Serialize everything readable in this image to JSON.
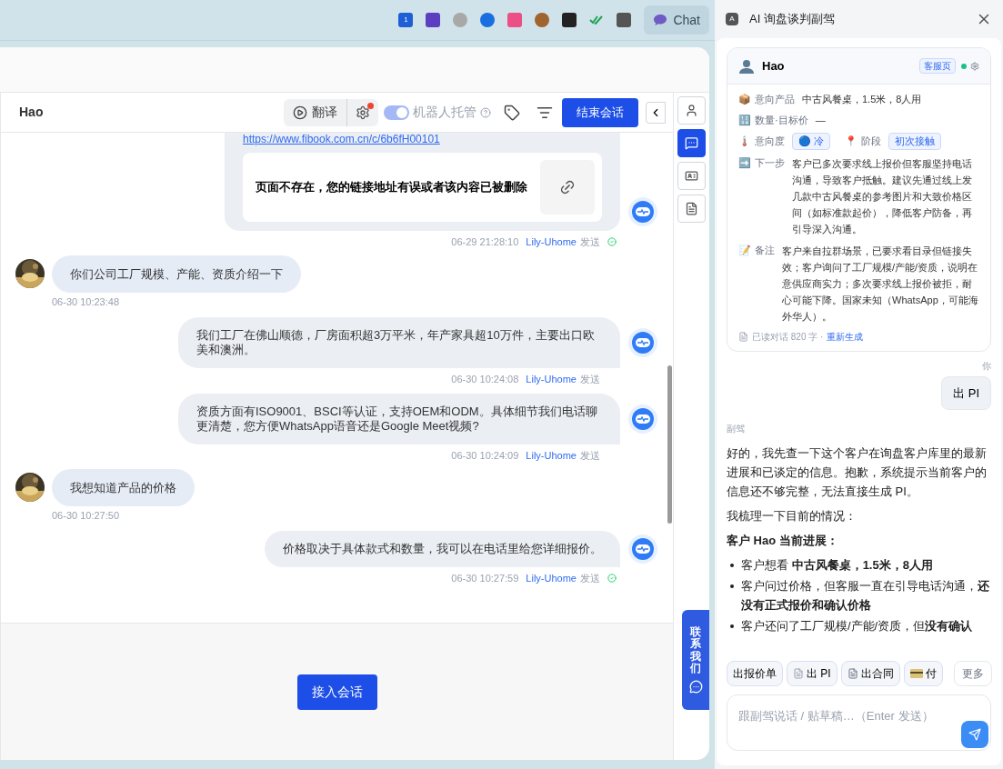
{
  "browser_bar": {
    "extension_badge": "1",
    "chat_button": "Chat"
  },
  "conversation": {
    "name": "Hao",
    "translate": "翻译",
    "settings_badge": true,
    "robot": {
      "label": "机器人托管",
      "on": true
    },
    "end_button": "结束会话",
    "side_tabs": [
      {
        "selected": false
      },
      {
        "selected": true
      },
      {
        "selected": false
      },
      {
        "selected": false
      }
    ],
    "link_text": "https://www.fibook.com.cn/c/6b6fH00101",
    "link_card": "页面不存在，您的链接地址有误或者该内容已被删除",
    "link_meta": {
      "time": "06-29 21:28:10",
      "sender": "Lily-Uhome",
      "action": "发送",
      "delivered": true
    },
    "messages": [
      {
        "kind": "customer",
        "text": "你们公司工厂规模、产能、资质介绍一下",
        "time": "06-30 10:23:48"
      },
      {
        "kind": "agent",
        "text": "我们工厂在佛山顺德，厂房面积超3万平米，年产家具超10万件，主要出口欧美和澳洲。",
        "time": "06-30 10:24:08",
        "sender": "Lily-Uhome",
        "action": "发送",
        "delivered": false
      },
      {
        "kind": "agent",
        "text": "资质方面有ISO9001、BSCI等认证，支持OEM和ODM。具体细节我们电话聊更清楚，您方便WhatsApp语音还是Google Meet视频?",
        "time": "06-30 10:24:09",
        "sender": "Lily-Uhome",
        "action": "发送",
        "delivered": false
      },
      {
        "kind": "customer",
        "text": "我想知道产品的价格",
        "time": "06-30 10:27:50"
      },
      {
        "kind": "agent",
        "text": "价格取决于具体款式和数量，我可以在电话里给您详细报价。",
        "time": "06-30 10:27:59",
        "sender": "Lily-Uhome",
        "action": "发送",
        "delivered": true
      }
    ],
    "join_button": "接入会话",
    "contact_tab": "联系我们"
  },
  "copilot": {
    "title": "AI 询盘谈判副驾",
    "badge_letter": "A",
    "customer_card": {
      "name": "Hao",
      "source_tag": "客服页",
      "online": true,
      "fields": [
        {
          "kind": "text",
          "icon": "📦",
          "label": "意向产品",
          "value": "中古风餐桌，1.5米，8人用"
        },
        {
          "kind": "text",
          "icon": "🔢",
          "label": "数量·目标价",
          "value": "—"
        },
        {
          "kind": "tags",
          "icon": "🌡️",
          "label": "意向度",
          "value": "🔵 冷",
          "label2": "阶段",
          "icon2": "📍",
          "value2": "初次接触"
        },
        {
          "kind": "para",
          "icon": "➡️",
          "label": "下一步",
          "value": "客户已多次要求线上报价但客服坚持电话沟通，导致客户抵触。建议先通过线上发几款中古风餐桌的参考图片和大致价格区间（如标准款起价），降低客户防备，再引导深入沟通。"
        },
        {
          "kind": "para",
          "icon": "📝",
          "label": "备注",
          "value": "客户来自拉群场景，已要求看目录但链接失效；客户询问了工厂规模/产能/资质，说明在意供应商实力；多次要求线上报价被拒，耐心可能下降。国家未知（WhatsApp，可能海外华人）。"
        }
      ],
      "footer": "已读对话 820 字 ·",
      "regenerate": "重新生成"
    },
    "chat": [
      {
        "kind": "user",
        "who": "你",
        "text": "出 PI"
      },
      {
        "kind": "assistant",
        "who": "副驾",
        "paragraphs": [
          "好的，我先查一下这个客户在询盘客户库里的最新进展和已谈定的信息。抱歉，系统提示当前客户的信息还不够完整，无法直接生成 PI。",
          "我梳理一下目前的情况：",
          "**客户 Hao 当前进展：**"
        ],
        "bullets": [
          "客户想看 **中古风餐桌，1.5米，8人用**",
          "客户问过价格，但客服一直在引导电话沟通，**还没有正式报价和确认价格**",
          "客户还问了工厂规模/产能/资质，但**没有确认**"
        ]
      }
    ],
    "chips": [
      {
        "kind": "plain",
        "label": "出报价单"
      },
      {
        "kind": "pi",
        "label": "出 PI"
      },
      {
        "kind": "contract",
        "label": "出合同"
      },
      {
        "kind": "payment",
        "label": "付"
      }
    ],
    "more": "更多",
    "input_placeholder": "跟副驾说话 / 贴草稿…（Enter 发送）"
  }
}
